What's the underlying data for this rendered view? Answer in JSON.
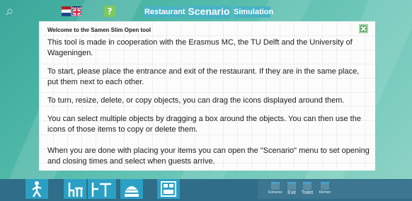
{
  "colors": {
    "background": "#4fb8a8",
    "menu_button": "#48b3c4",
    "help_button": "#7ec95a",
    "close_button": "#52a65a",
    "toolbar": "#2f6d88",
    "tool_tile": "#2aa0c4"
  },
  "topbar": {
    "flags": [
      "nl-flag-icon",
      "uk-flag-icon"
    ],
    "help_label": "?",
    "menu": {
      "restaurant": "Restaurant",
      "scenario": "Scenario",
      "simulation": "Simulation"
    }
  },
  "dialog": {
    "title": "Welcome to the Samen Slim Open tool",
    "close_icon": "close-x-icon",
    "paragraphs": [
      "This tool is made in cooperation with the Erasmus MC, the TU Delft and the University of Wageningen.",
      "To start, please place the entrance and exit of the restaurant. If they are in the same place, put  them next to each other.",
      "To turn, resize, delete, or copy objects, you can drag the icons displayed around them.",
      "You can select multiple objects by dragging a box around the objects. You can then use the icons of those items to copy or delete them.",
      "When you are done with placing your items you can open the \"Scenario\" menu to set opening and closing times and select when guests arrive."
    ]
  },
  "toolbar": {
    "tools": [
      "search-icon",
      "person-icon",
      "chair-table-icon",
      "table-icon",
      "cooking-icon",
      "area-icon"
    ],
    "extras": {
      "entrance": "Entrance",
      "exit": "Exit",
      "toilet": "Toilet",
      "kitchen": "Kitchen"
    }
  }
}
